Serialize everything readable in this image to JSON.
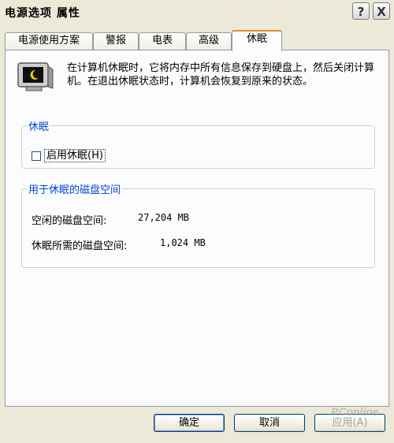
{
  "window": {
    "title": "电源选项 属性",
    "help_label": "?",
    "close_label": "X"
  },
  "tabs": [
    {
      "label": "电源使用方案"
    },
    {
      "label": "警报"
    },
    {
      "label": "电表"
    },
    {
      "label": "高级"
    },
    {
      "label": "休眠",
      "active": true
    }
  ],
  "description": "在计算机休眠时，它将内存中所有信息保存到硬盘上，然后关闭计算机。在退出休眠状态时，计算机会恢复到原来的状态。",
  "hibernate_group": {
    "legend": "休眠",
    "checkbox_label": "启用休眠(H)",
    "checked": false
  },
  "disk_group": {
    "legend": "用于休眠的磁盘空间",
    "free_label": "空闲的磁盘空间:",
    "free_value": "27,204 MB",
    "required_label": "休眠所需的磁盘空间:",
    "required_value": "1,024 MB"
  },
  "buttons": {
    "ok": "确定",
    "cancel": "取消",
    "apply": "应用(A)"
  },
  "watermark": "PConline"
}
